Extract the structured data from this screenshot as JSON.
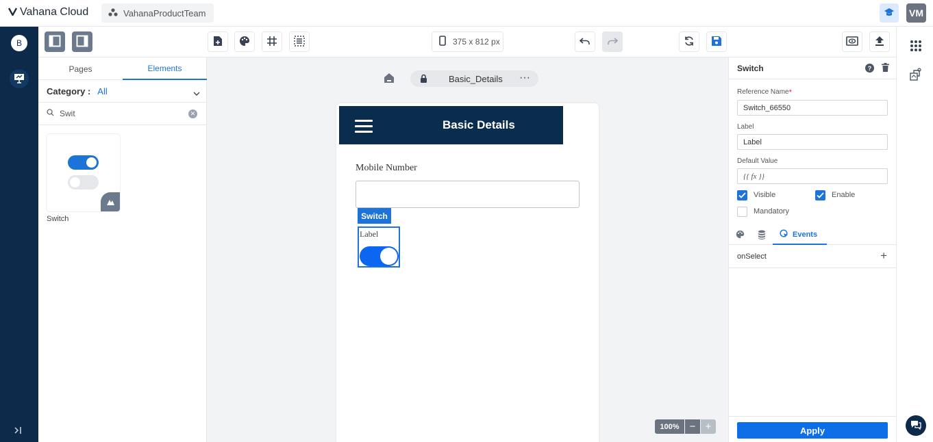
{
  "header": {
    "app_name": "Vahana Cloud",
    "team": "VahanaProductTeam",
    "user_initials": "VM"
  },
  "rail": {
    "workspace_initial": "B"
  },
  "toolbar": {
    "device_size": "375 x 812 px"
  },
  "left_panel": {
    "tabs": [
      "Pages",
      "Elements"
    ],
    "active_tab": "Elements",
    "category_label": "Category :",
    "category_value": "All",
    "search_value": "Swit",
    "results": [
      {
        "label": "Switch"
      }
    ]
  },
  "canvas": {
    "page_name": "Basic_Details",
    "app_title": "Basic Details",
    "mobile_label": "Mobile Number",
    "selected_tag": "Switch",
    "switch_label": "Label",
    "switch_on": true,
    "zoom": "100%"
  },
  "properties": {
    "title": "Switch",
    "reference_name_label": "Reference Name",
    "required_mark": "*",
    "reference_name": "Switch_66550",
    "label_label": "Label",
    "label_value": "Label",
    "default_value_label": "Default Value",
    "default_value": "{{ fx }}",
    "visible_label": "Visible",
    "visible": true,
    "enable_label": "Enable",
    "enable": true,
    "mandatory_label": "Mandatory",
    "mandatory": false,
    "events_tab": "Events",
    "event_name": "onSelect",
    "apply_label": "Apply"
  },
  "colors": {
    "accent": "#1d73d8",
    "rail": "#0d2a4a",
    "app_header": "#0b2d4d"
  }
}
